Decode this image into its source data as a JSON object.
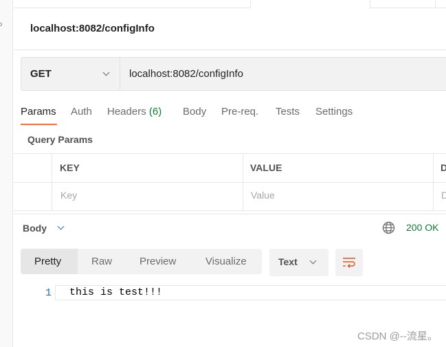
{
  "request": {
    "title": "localhost:8082/configInfo",
    "method": "GET",
    "url": "localhost:8082/configInfo"
  },
  "tabs": [
    {
      "label": "Params",
      "active": true
    },
    {
      "label": "Auth"
    },
    {
      "label": "Headers",
      "count": "(6)"
    },
    {
      "label": "Body"
    },
    {
      "label": "Pre-req."
    },
    {
      "label": "Tests"
    },
    {
      "label": "Settings"
    }
  ],
  "query_params": {
    "heading": "Query Params",
    "columns": [
      "KEY",
      "VALUE",
      "D"
    ],
    "placeholders": {
      "key": "Key",
      "value": "Value",
      "desc": "D"
    }
  },
  "response": {
    "section": "Body",
    "status": "200 OK",
    "views": [
      "Pretty",
      "Raw",
      "Preview",
      "Visualize"
    ],
    "active_view": "Pretty",
    "format": "Text",
    "lines": [
      {
        "number": "1",
        "text": "this is test!!!"
      }
    ]
  },
  "colors": {
    "accent": "#ff6c37",
    "status_ok": "#0f7b37"
  },
  "watermark": "CSDN @--流星。"
}
